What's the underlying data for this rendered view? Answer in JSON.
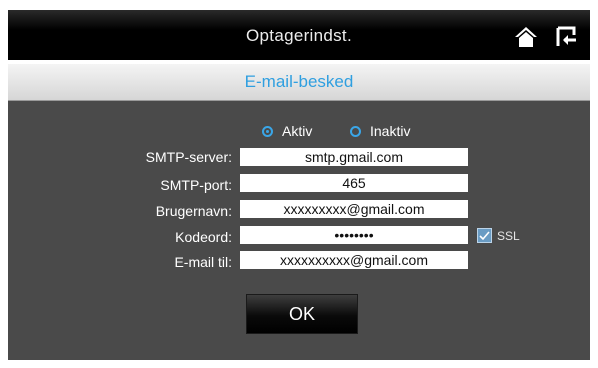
{
  "header": {
    "title": "Optagerindst.",
    "home_icon": "home-icon",
    "exit_icon": "exit-icon"
  },
  "subheader": {
    "title": "E-mail-besked",
    "color": "#2f9fe0"
  },
  "mode": {
    "options": [
      {
        "label": "Aktiv",
        "selected": true
      },
      {
        "label": "Inaktiv",
        "selected": false
      }
    ]
  },
  "form": {
    "fields": [
      {
        "label": "SMTP-server:",
        "value": "smtp.gmail.com"
      },
      {
        "label": "SMTP-port:",
        "value": "465"
      },
      {
        "label": "Brugernavn:",
        "value": "xxxxxxxxx@gmail.com"
      },
      {
        "label": "Kodeord:",
        "value": "••••••••"
      },
      {
        "label": "E-mail til:",
        "value": "xxxxxxxxxx@gmail.com"
      }
    ],
    "ssl": {
      "label": "SSL",
      "checked": true
    }
  },
  "buttons": {
    "ok": "OK"
  },
  "colors": {
    "accent": "#3aa6e8",
    "panel": "#4a4a4a",
    "header": "#000000"
  }
}
